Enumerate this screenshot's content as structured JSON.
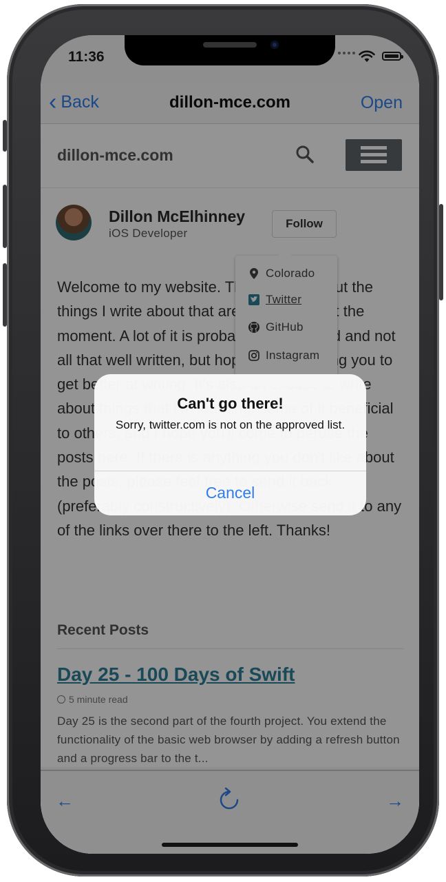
{
  "status_bar": {
    "time": "11:36"
  },
  "nav_bar": {
    "back_label": "Back",
    "title": "dillon-mce.com",
    "open_label": "Open"
  },
  "site_header": {
    "site_name": "dillon-mce.com"
  },
  "author": {
    "name": "Dillon McElhinney",
    "bio": "iOS Developer",
    "follow_label": "Follow"
  },
  "follow_menu": {
    "items": [
      {
        "label": "Colorado",
        "icon": "location-pin-icon"
      },
      {
        "label": "Twitter",
        "icon": "twitter-icon"
      },
      {
        "label": "GitHub",
        "icon": "github-icon"
      },
      {
        "label": "Instagram",
        "icon": "instagram-icon"
      }
    ]
  },
  "page": {
    "intro": "Welcome to my website. This is where I put the things I write about that are on my mind at the moment. A lot of it is probably not polished and not all that well written, but hopefully it's forcing you to get better at writing. It's also an excuse to write about things that I'm learning, some of it beneficial to others, and I hope you'll come to peruse the posts here. If there is anything you don't like about the posts, please feel free to send it back (preferably constructively). Otherwise send it to any of the links over there to the left. Thanks!",
    "recent_posts_heading": "Recent Posts",
    "post": {
      "title": "Day 25 - 100 Days of Swift",
      "read_time": "5 minute read",
      "excerpt": "Day 25 is the second part of the fourth project. You extend the functionality of the basic web browser by adding a refresh button and a progress bar to the t..."
    }
  },
  "toolbar": {
    "back_glyph": "←",
    "forward_glyph": "→"
  },
  "alert": {
    "title": "Can't go there!",
    "message": "Sorry, twitter.com is not on the approved list.",
    "cancel_label": "Cancel"
  },
  "colors": {
    "ios_blue": "#2f7dea",
    "link_teal": "#2d7f96",
    "menu_button": "#5e6469",
    "overlay": "rgba(0,0,0,0.42)"
  }
}
